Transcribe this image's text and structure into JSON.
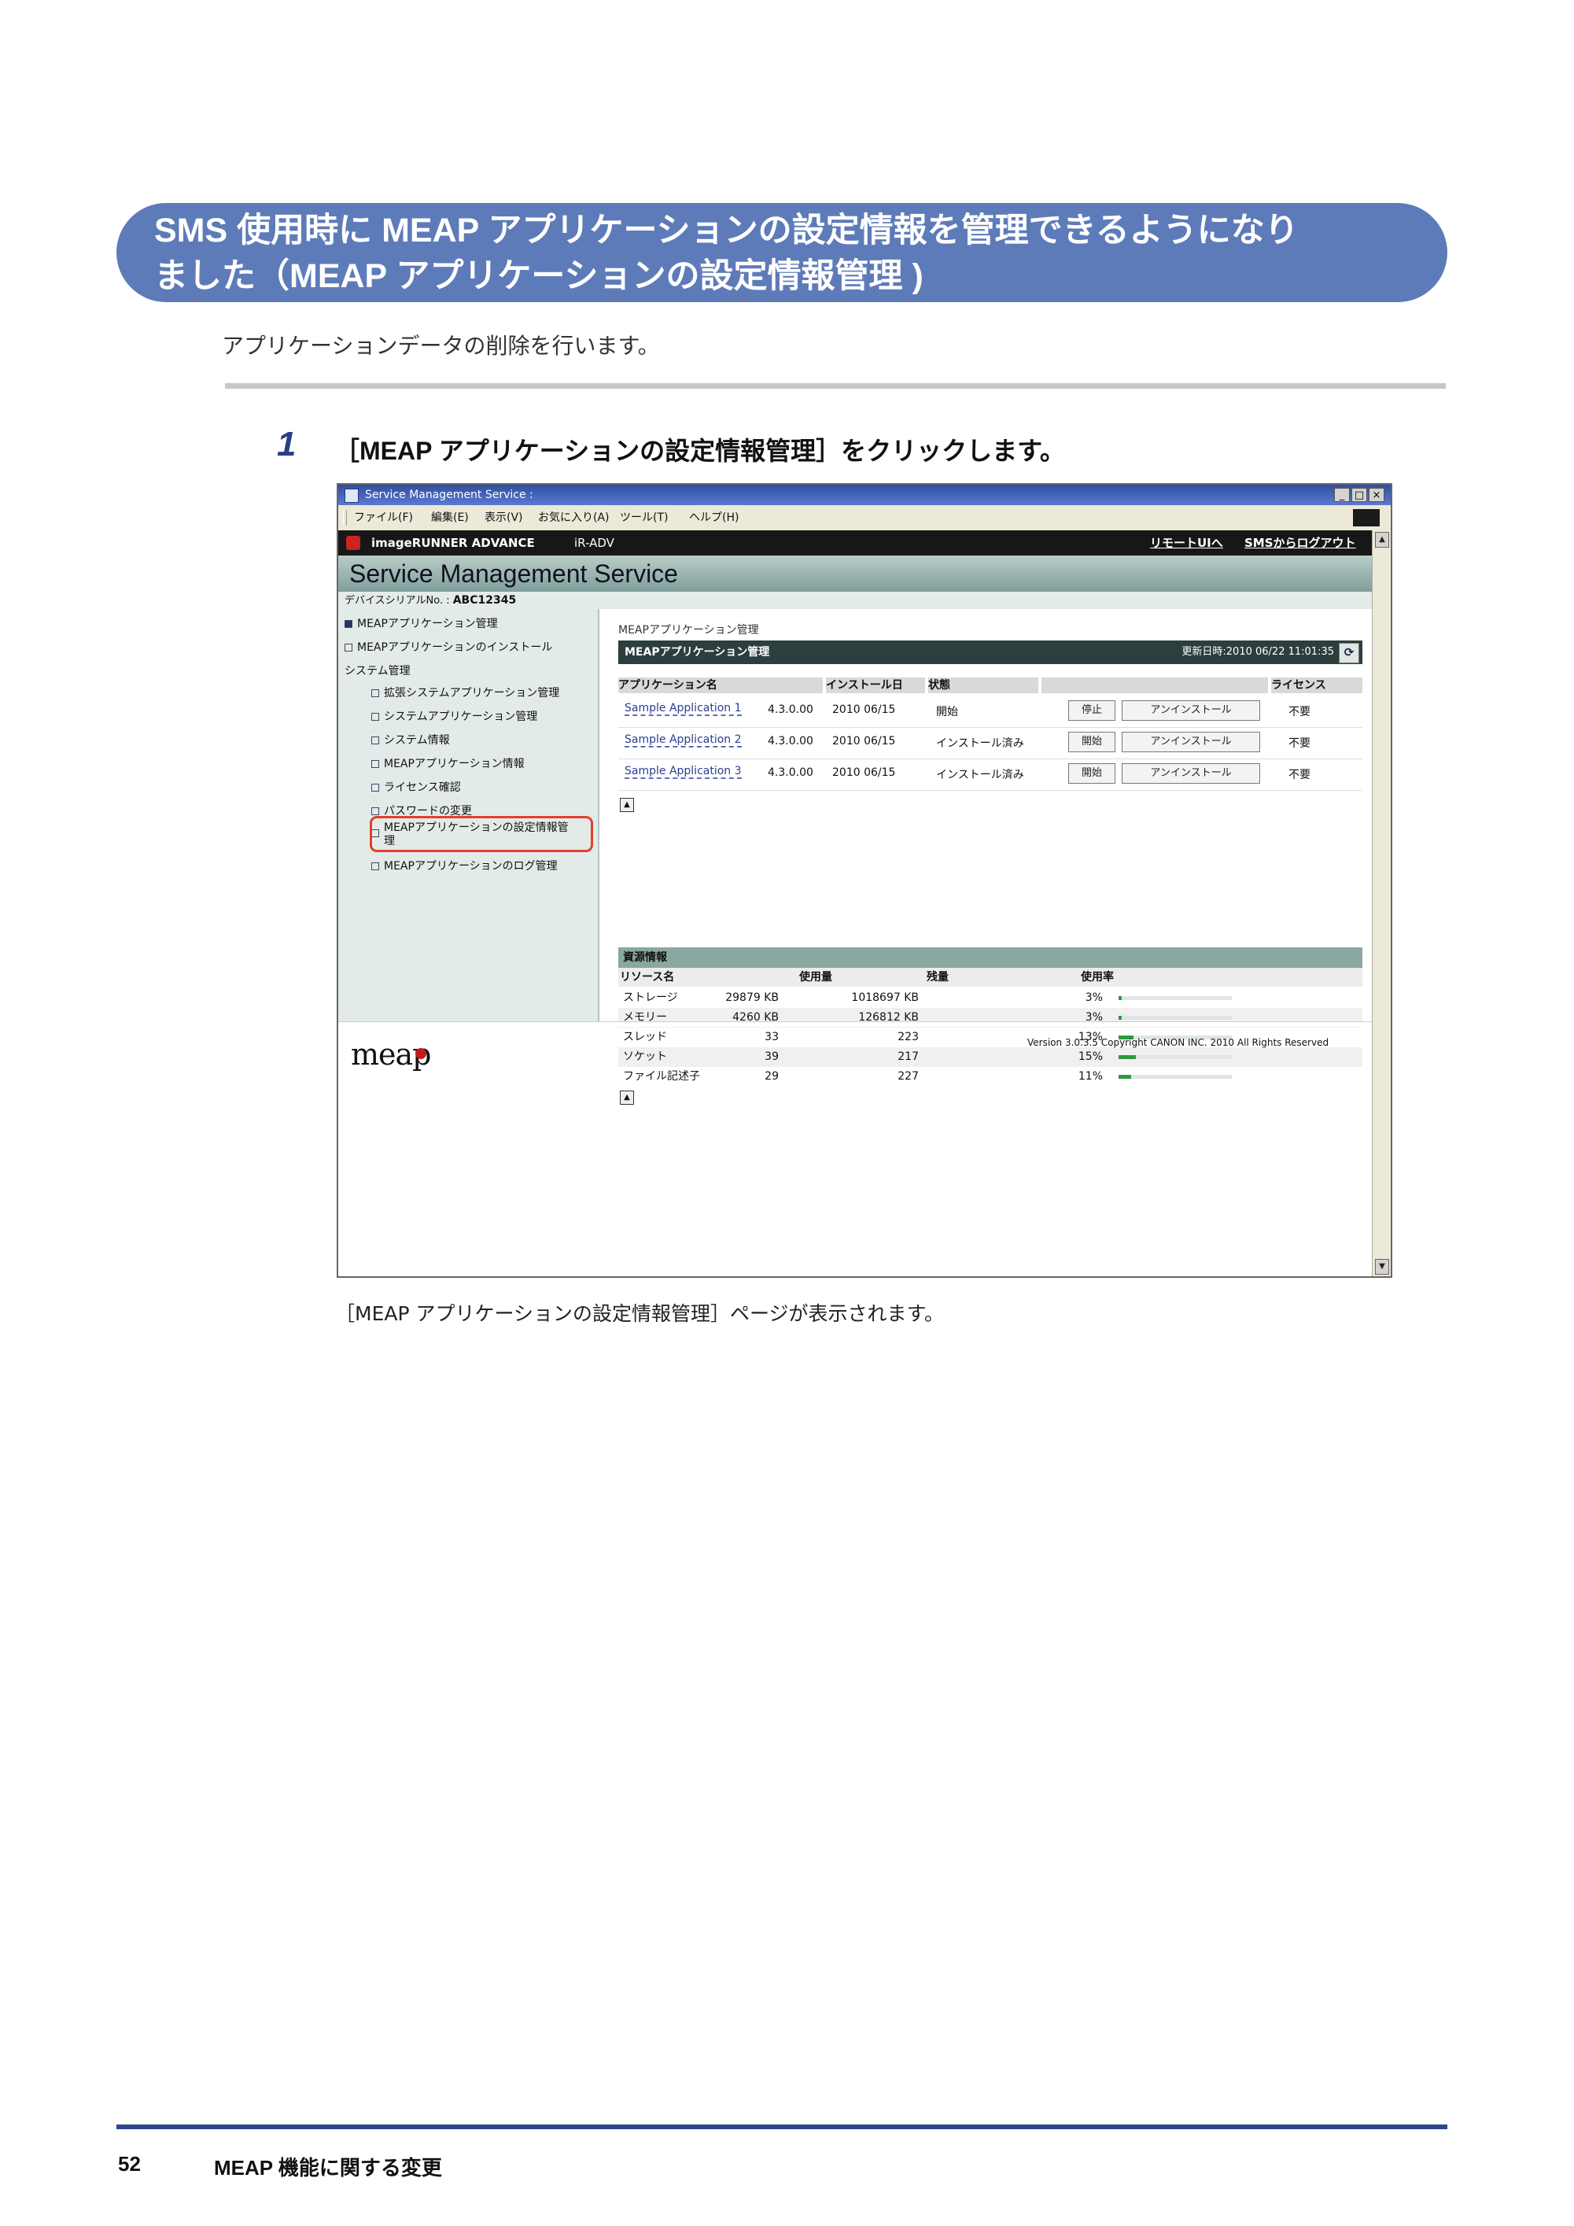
{
  "banner": {
    "line1": "SMS 使用時に MEAP アプリケーションの設定情報を管理できるようになり",
    "line2": "ました（MEAP アプリケーションの設定情報管理 )"
  },
  "intro": "アプリケーションデータの削除を行います。",
  "step": {
    "number": "1",
    "text": "［MEAP アプリケーションの設定情報管理］をクリックします。"
  },
  "window": {
    "title": "Service Management Service :",
    "controls": {
      "minimize": "_",
      "maximize": "□",
      "close": "×"
    },
    "menu": [
      "ファイル(F)",
      "編集(E)",
      "表示(V)",
      "お気に入り(A)",
      "ツール(T)",
      "ヘルプ(H)"
    ],
    "brand": "imageRUNNER ADVANCE",
    "model": "iR-ADV",
    "links": {
      "remote_ui": "リモートUIへ",
      "logout": "SMSからログアウト"
    },
    "sms_title": "Service Management Service",
    "serial_label": "デバイスシリアルNo. :",
    "serial": "ABC12345",
    "sidebar": {
      "items_top": [
        "MEAPアプリケーション管理",
        "MEAPアプリケーションのインストール"
      ],
      "section": "システム管理",
      "items_sub": [
        "拡張システムアプリケーション管理",
        "システムアプリケーション管理",
        "システム情報",
        "MEAPアプリケーション情報",
        "ライセンス確認",
        "パスワードの変更"
      ],
      "highlight_line1": "MEAPアプリケーションの設定情報管",
      "highlight_line2": "理",
      "last_item": "MEAPアプリケーションのログ管理"
    },
    "main": {
      "breadcrumb": "MEAPアプリケーション管理",
      "header": "MEAPアプリケーション管理",
      "updated": "更新日時:2010 06/22 11:01:35",
      "refresh_icon": "⟳",
      "columns": {
        "name": "アプリケーション名",
        "install_date": "インストール日",
        "status": "状態",
        "license": "ライセンス"
      },
      "apps": [
        {
          "name": "Sample Application 1",
          "version": "4.3.0.00",
          "date": "2010 06/15",
          "status": "開始",
          "action": "停止",
          "uninstall": "アンインストール",
          "license": "不要"
        },
        {
          "name": "Sample Application 2",
          "version": "4.3.0.00",
          "date": "2010 06/15",
          "status": "インストール済み",
          "action": "開始",
          "uninstall": "アンインストール",
          "license": "不要"
        },
        {
          "name": "Sample Application 3",
          "version": "4.3.0.00",
          "date": "2010 06/15",
          "status": "インストール済み",
          "action": "開始",
          "uninstall": "アンインストール",
          "license": "不要"
        }
      ],
      "resources_header": "資源情報",
      "resource_columns": {
        "name": "リソース名",
        "used": "使用量",
        "remaining": "残量",
        "rate": "使用率"
      },
      "resources": [
        {
          "name": "ストレージ",
          "used": "29879 KB",
          "remaining": "1018697 KB",
          "rate": "3%",
          "rate_value": 0.03
        },
        {
          "name": "メモリー",
          "used": "4260 KB",
          "remaining": "126812 KB",
          "rate": "3%",
          "rate_value": 0.03
        },
        {
          "name": "スレッド",
          "used": "33",
          "remaining": "223",
          "rate": "13%",
          "rate_value": 0.13
        },
        {
          "name": "ソケット",
          "used": "39",
          "remaining": "217",
          "rate": "15%",
          "rate_value": 0.15
        },
        {
          "name": "ファイル記述子",
          "used": "29",
          "remaining": "227",
          "rate": "11%",
          "rate_value": 0.11
        }
      ]
    },
    "logo": "meap",
    "version": "Version 3.0.3.5 Copyright CANON INC. 2010 All Rights Reserved"
  },
  "caption": "［MEAP アプリケーションの設定情報管理］ページが表示されます。",
  "footer": {
    "page": "52",
    "chapter": "MEAP 機能に関する変更"
  },
  "colors": {
    "banner": "#5e7bb9",
    "footer_rule": "#2f4690",
    "highlight": "#e0402e",
    "usage_bar": "#2c9a3c"
  }
}
